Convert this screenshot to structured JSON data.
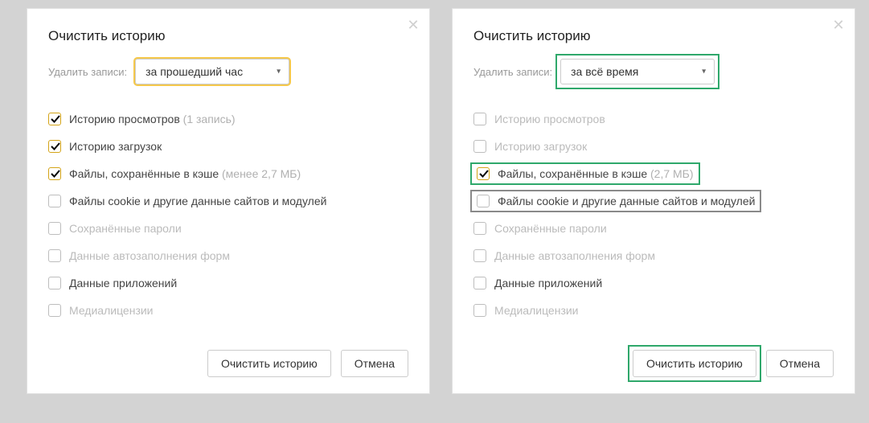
{
  "dialogs": {
    "left": {
      "title": "Очистить историю",
      "selectLabel": "Удалить записи:",
      "selectValue": "за прошедший час",
      "options": {
        "browsing": {
          "label": "Историю просмотров",
          "hint": "(1 запись)"
        },
        "downloads": {
          "label": "Историю загрузок"
        },
        "cache": {
          "label": "Файлы, сохранённые в кэше",
          "hint": "(менее 2,7 МБ)"
        },
        "cookies": {
          "label": "Файлы cookie и другие данные сайтов и модулей"
        },
        "passwords": {
          "label": "Сохранённые пароли"
        },
        "autofill": {
          "label": "Данные автозаполнения форм"
        },
        "apps": {
          "label": "Данные приложений"
        },
        "media": {
          "label": "Медиалицензии"
        }
      },
      "clearBtn": "Очистить историю",
      "cancelBtn": "Отмена"
    },
    "right": {
      "title": "Очистить историю",
      "selectLabel": "Удалить записи:",
      "selectValue": "за всё время",
      "options": {
        "browsing": {
          "label": "Историю просмотров"
        },
        "downloads": {
          "label": "Историю загрузок"
        },
        "cache": {
          "label": "Файлы, сохранённые в кэше",
          "hint": "(2,7 МБ)"
        },
        "cookies": {
          "label": "Файлы cookie и другие данные сайтов и модулей"
        },
        "passwords": {
          "label": "Сохранённые пароли"
        },
        "autofill": {
          "label": "Данные автозаполнения форм"
        },
        "apps": {
          "label": "Данные приложений"
        },
        "media": {
          "label": "Медиалицензии"
        }
      },
      "clearBtn": "Очистить историю",
      "cancelBtn": "Отмена"
    }
  }
}
